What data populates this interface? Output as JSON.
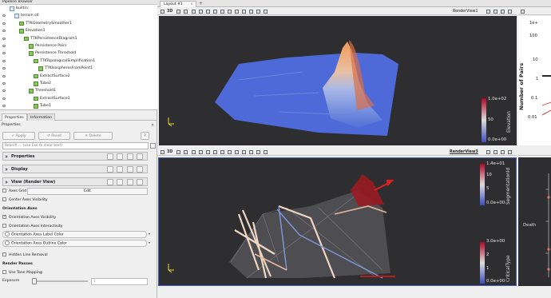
{
  "pipeline": {
    "title": "Pipeline Browser",
    "items": [
      {
        "label": "builtin:",
        "indent": 0,
        "icon": "server"
      },
      {
        "label": "terrain.stl",
        "indent": 1,
        "icon": "source"
      },
      {
        "label": "TTKGeometrySmoother1",
        "indent": 2,
        "icon": "filter"
      },
      {
        "label": "Elevation1",
        "indent": 2,
        "icon": "filter"
      },
      {
        "label": "TTKPersistenceDiagram1",
        "indent": 3,
        "icon": "filter"
      },
      {
        "label": "Persistence Pairs",
        "indent": 4,
        "icon": "filter"
      },
      {
        "label": "Persistence Threshold",
        "indent": 4,
        "icon": "filter"
      },
      {
        "label": "TTKTopologicalSimplification1",
        "indent": 5,
        "icon": "filter"
      },
      {
        "label": "TTKIsospheresFromPoint1",
        "indent": 6,
        "icon": "filter"
      },
      {
        "label": "ExtractSurface2",
        "indent": 5,
        "icon": "filter"
      },
      {
        "label": "Tube2",
        "indent": 5,
        "icon": "filter"
      },
      {
        "label": "Threshold1",
        "indent": 4,
        "icon": "filter"
      },
      {
        "label": "ExtractSurface1",
        "indent": 5,
        "icon": "filter"
      },
      {
        "label": "Tube1",
        "indent": 5,
        "icon": "filter"
      }
    ]
  },
  "tabs": {
    "properties": "Properties",
    "information": "Information"
  },
  "props": {
    "title": "Properties",
    "apply": "Apply",
    "reset": "Reset",
    "delete": "Delete",
    "help": "?",
    "search_placeholder": "Search ... (use Esc to clear text)",
    "sections": {
      "properties": "Properties",
      "display": "Display",
      "view": "View (Render View)"
    },
    "axes_grid": "Axes Grid",
    "edit": "Edit",
    "center_axes": "Center Axes Visibility",
    "orientation_axes": "Orientation Axes",
    "oa_visibility": "Orientation Axes Visibility",
    "oa_interactivity": "Orientation Axes Interactivity",
    "oa_label_color": "Orientation Axes Label Color",
    "oa_outline_color": "Orientation Axes Outline Color",
    "hidden_line": "Hidden Line Removal",
    "render_passes": "Render Passes",
    "tone_mapping": "Use Tone Mapping",
    "exposure": "Exposure",
    "exposure_value": "1"
  },
  "layout": {
    "tab": "Layout #1",
    "close": "×",
    "add": "+"
  },
  "view1": {
    "label": "RenderView1",
    "btn3d": "3D",
    "colorbar": {
      "name": "Elevation",
      "max": "1.0e+02",
      "mid": "50",
      "min": "0.0e+00"
    }
  },
  "view3": {
    "label": "RenderView3",
    "btn3d": "3D",
    "colorbar1": {
      "name": "SegmentationId",
      "max": "1.4e+01",
      "t1": "10",
      "t2": "5",
      "min": "0.0e+00"
    },
    "colorbar2": {
      "name": "CriticalType",
      "max": "3.0e+00",
      "t1": "2",
      "t2": "1",
      "min": "0.0e+00"
    }
  },
  "chart": {
    "ylabel": "Number of Pairs",
    "ticks": [
      "1e+",
      "100",
      "10",
      "1",
      "0.1",
      "0.01"
    ],
    "xlabel2": "Death"
  },
  "colors": {
    "accent": "#4a5cc2",
    "bar_red": "#cc2a2a",
    "bar_blue": "#3a5bc7"
  }
}
